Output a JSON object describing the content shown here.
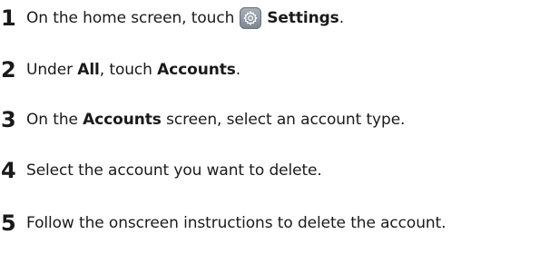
{
  "steps": [
    {
      "number": "1",
      "pre": "On the home screen, touch",
      "bold": "Settings",
      "post": "."
    },
    {
      "number": "2",
      "pre": "Under ",
      "bold1": "All",
      "mid": ", touch ",
      "bold2": "Accounts",
      "post": "."
    },
    {
      "number": "3",
      "pre": "On the ",
      "bold": "Accounts",
      "post": " screen, select an account type."
    },
    {
      "number": "4",
      "text": "Select the account you want to delete."
    },
    {
      "number": "5",
      "text": "Follow the onscreen instructions to delete the account."
    }
  ],
  "icons": {
    "settings": "settings-gear-icon",
    "color": "#8a929b"
  }
}
